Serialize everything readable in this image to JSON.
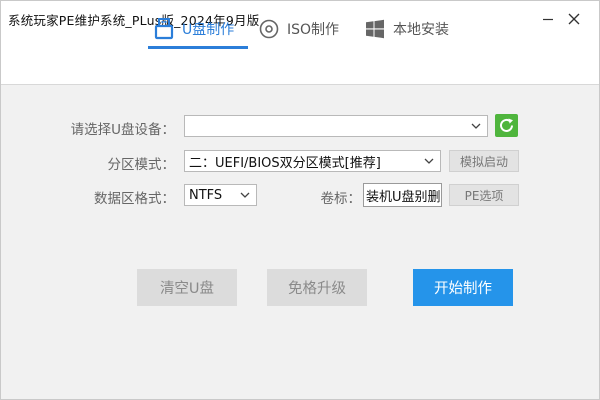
{
  "window": {
    "title": "系统玩家PE维护系统_PLus版_2024年9月版"
  },
  "tabs": [
    {
      "label": "U盘制作",
      "icon": "usb-icon",
      "active": true
    },
    {
      "label": "ISO制作",
      "icon": "disc-icon",
      "active": false
    },
    {
      "label": "本地安装",
      "icon": "windows-icon",
      "active": false
    }
  ],
  "form": {
    "device_label": "请选择U盘设备：",
    "device_value": "",
    "partition_label": "分区模式：",
    "partition_value": "二：UEFI/BIOS双分区模式[推荐]",
    "simulate_label": "模拟启动",
    "format_label": "数据区格式：",
    "format_value": "NTFS",
    "volume_label": "卷标：",
    "volume_value": "装机U盘别删",
    "pe_options_label": "PE选项"
  },
  "actions": {
    "clear_label": "清空U盘",
    "upgrade_label": "免格升级",
    "start_label": "开始制作"
  },
  "colors": {
    "accent": "#2b7ed9",
    "start_button": "#2594ea",
    "refresh": "#4fb53d"
  }
}
